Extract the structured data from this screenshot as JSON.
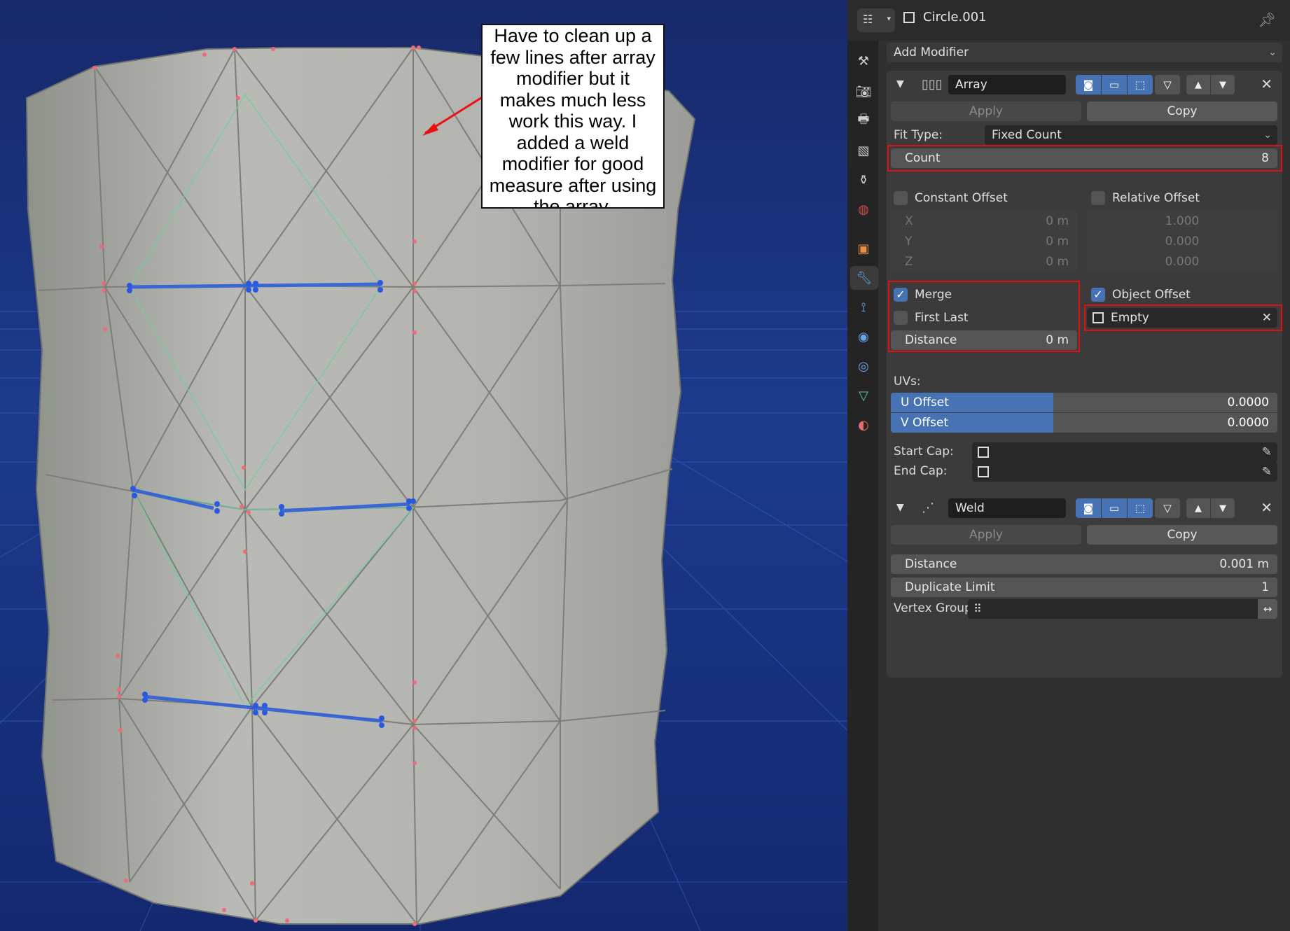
{
  "annotation": {
    "text": "Have to clean up a\nfew lines after array\nmodifier but it\nmakes much less\nwork this way. I\nadded a weld\nmodifier for good\nmeasure after using\nthe array."
  },
  "header": {
    "object_name": "Circle.001"
  },
  "add_modifier": {
    "label": "Add Modifier"
  },
  "array": {
    "name": "Array",
    "apply_label": "Apply",
    "copy_label": "Copy",
    "fit_type_label": "Fit Type:",
    "fit_type_value": "Fixed Count",
    "count_label": "Count",
    "count_value": "8",
    "constant_offset_label": "Constant Offset",
    "relative_offset_label": "Relative Offset",
    "constant": [
      {
        "axis": "X",
        "value": "0 m"
      },
      {
        "axis": "Y",
        "value": "0 m"
      },
      {
        "axis": "Z",
        "value": "0 m"
      }
    ],
    "relative": [
      "1.000",
      "0.000",
      "0.000"
    ],
    "merge_label": "Merge",
    "first_last_label": "First Last",
    "distance_label": "Distance",
    "distance_value": "0 m",
    "object_offset_label": "Object Offset",
    "object_offset_value": "Empty",
    "uvs_label": "UVs:",
    "u_offset_label": "U Offset",
    "u_offset_value": "0.0000",
    "v_offset_label": "V Offset",
    "v_offset_value": "0.0000",
    "start_cap_label": "Start Cap:",
    "end_cap_label": "End Cap:"
  },
  "weld": {
    "name": "Weld",
    "apply_label": "Apply",
    "copy_label": "Copy",
    "distance_label": "Distance",
    "distance_value": "0.001 m",
    "duplicate_limit_label": "Duplicate Limit",
    "duplicate_limit_value": "1",
    "vertex_group_label": "Vertex Group:"
  },
  "colors": {
    "viewport_bg": "#1a3580",
    "accent_blue": "#4772b3",
    "highlight_red": "#e01010",
    "panel_bg": "#303030"
  }
}
